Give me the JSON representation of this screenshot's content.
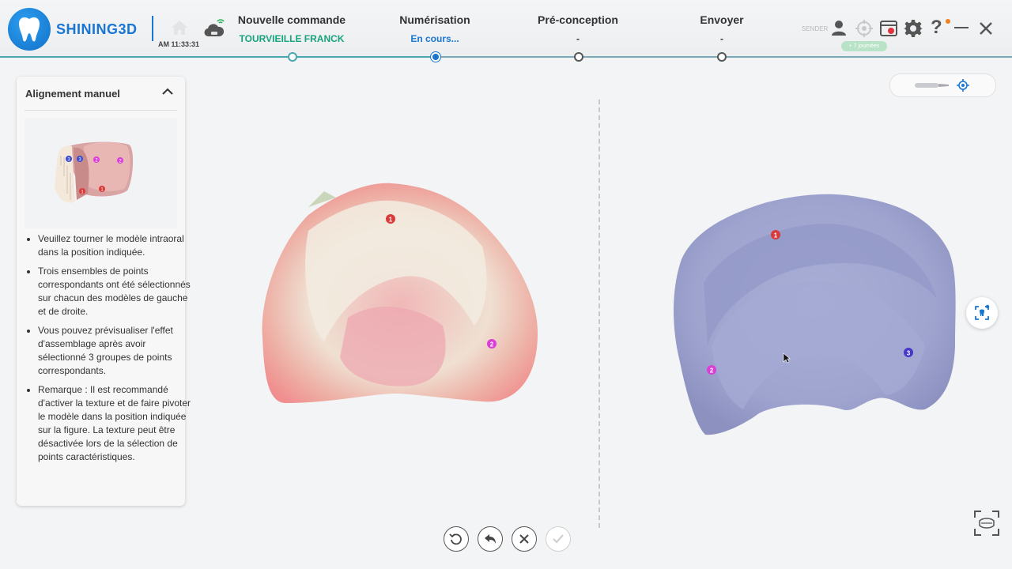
{
  "header": {
    "brand": "SHINING3D",
    "time": "AM 11:33:31",
    "steps": [
      {
        "title": "Nouvelle commande",
        "subtitle": "TOURVIEILLE FRANCK",
        "state": "done"
      },
      {
        "title": "Numérisation",
        "subtitle": "En cours...",
        "state": "active"
      },
      {
        "title": "Pré-conception",
        "subtitle": "-",
        "state": "pending"
      },
      {
        "title": "Envoyer",
        "subtitle": "-",
        "state": "pending"
      }
    ],
    "sender_label": "SENDER",
    "notice": "+ 7 journées",
    "icons": [
      "user-icon",
      "target-icon",
      "record-icon",
      "gear-icon",
      "help-icon",
      "minimize-icon",
      "close-icon"
    ],
    "colors": {
      "brand": "#1976d2",
      "done": "#19a37c",
      "active": "#1a76d2",
      "line": "#4aa6b0"
    }
  },
  "panel": {
    "title": "Alignement manuel",
    "instructions": [
      "Veuillez tourner le modèle intraoral dans la position indiquée.",
      "Trois ensembles de points correspondants ont été sélectionnés sur chacun des modèles de gauche et de droite.",
      "Vous pouvez prévisualiser l'effet d'assemblage après avoir sélectionné 3 groupes de points correspondants.",
      "Remarque : Il est recommandé d'activer la texture et de faire pivoter le modèle dans la position indiquée sur la figure. La texture peut être désactivée lors de la sélection de points caractéristiques."
    ],
    "thumb_points": [
      "3",
      "3",
      "2",
      "2",
      "1",
      "1"
    ]
  },
  "left_model": {
    "points": [
      {
        "label": "1",
        "color": "#d93a3a"
      },
      {
        "label": "2",
        "color": "#d93fd6"
      }
    ]
  },
  "right_model": {
    "points": [
      {
        "label": "1",
        "color": "#d93a3a"
      },
      {
        "label": "2",
        "color": "#d93fd6"
      },
      {
        "label": "3",
        "color": "#4638c8"
      }
    ]
  },
  "actions": [
    {
      "name": "reset-view-button",
      "icon": "rotate-icon",
      "enabled": true
    },
    {
      "name": "undo-button",
      "icon": "undo-icon",
      "enabled": true
    },
    {
      "name": "cancel-button",
      "icon": "x-icon",
      "enabled": true
    },
    {
      "name": "confirm-button",
      "icon": "check-icon",
      "enabled": false
    }
  ]
}
